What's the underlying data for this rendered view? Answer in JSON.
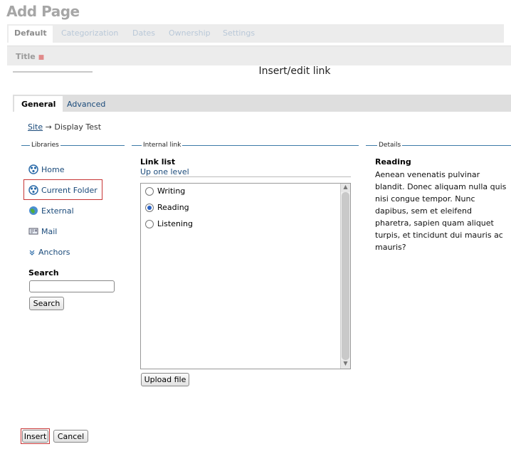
{
  "background_page": {
    "title": "Add Page",
    "tabs": [
      "Default",
      "Categorization",
      "Dates",
      "Ownership",
      "Settings"
    ],
    "field_label": "Title",
    "required_marker": "■"
  },
  "dialog": {
    "title": "Insert/edit link",
    "tabs": [
      {
        "label": "General"
      },
      {
        "label": "Advanced"
      }
    ],
    "breadcrumb": {
      "root": "Site",
      "separator": "→",
      "current": "Display Test"
    }
  },
  "libraries": {
    "legend": "Libraries",
    "items": [
      {
        "label": "Home",
        "icon": "home-icon"
      },
      {
        "label": "Current Folder",
        "icon": "folder-icon"
      },
      {
        "label": "External",
        "icon": "globe-icon"
      },
      {
        "label": "Mail",
        "icon": "mail-icon"
      },
      {
        "label": "Anchors",
        "icon": "anchor-icon"
      }
    ],
    "search_label": "Search",
    "search_value": "",
    "search_button": "Search"
  },
  "internal_link": {
    "legend": "Internal link",
    "list_title": "Link list",
    "up_link": "Up one level",
    "options": [
      {
        "label": "Writing",
        "selected": false
      },
      {
        "label": "Reading",
        "selected": true
      },
      {
        "label": "Listening",
        "selected": false
      }
    ],
    "upload_button": "Upload file"
  },
  "details": {
    "legend": "Details",
    "title": "Reading",
    "text": "Aenean venenatis pulvinar blandit. Donec aliquam nulla quis nisi congue tempor. Nunc dapibus, sem et eleifend pharetra, sapien quam aliquet turpis, et tincidunt dui mauris ac mauris?"
  },
  "footer": {
    "insert_button": "Insert",
    "cancel_button": "Cancel"
  },
  "colors": {
    "link": "#1a4a7a",
    "legend_line": "#3d7aa8",
    "highlight": "#c73535"
  }
}
